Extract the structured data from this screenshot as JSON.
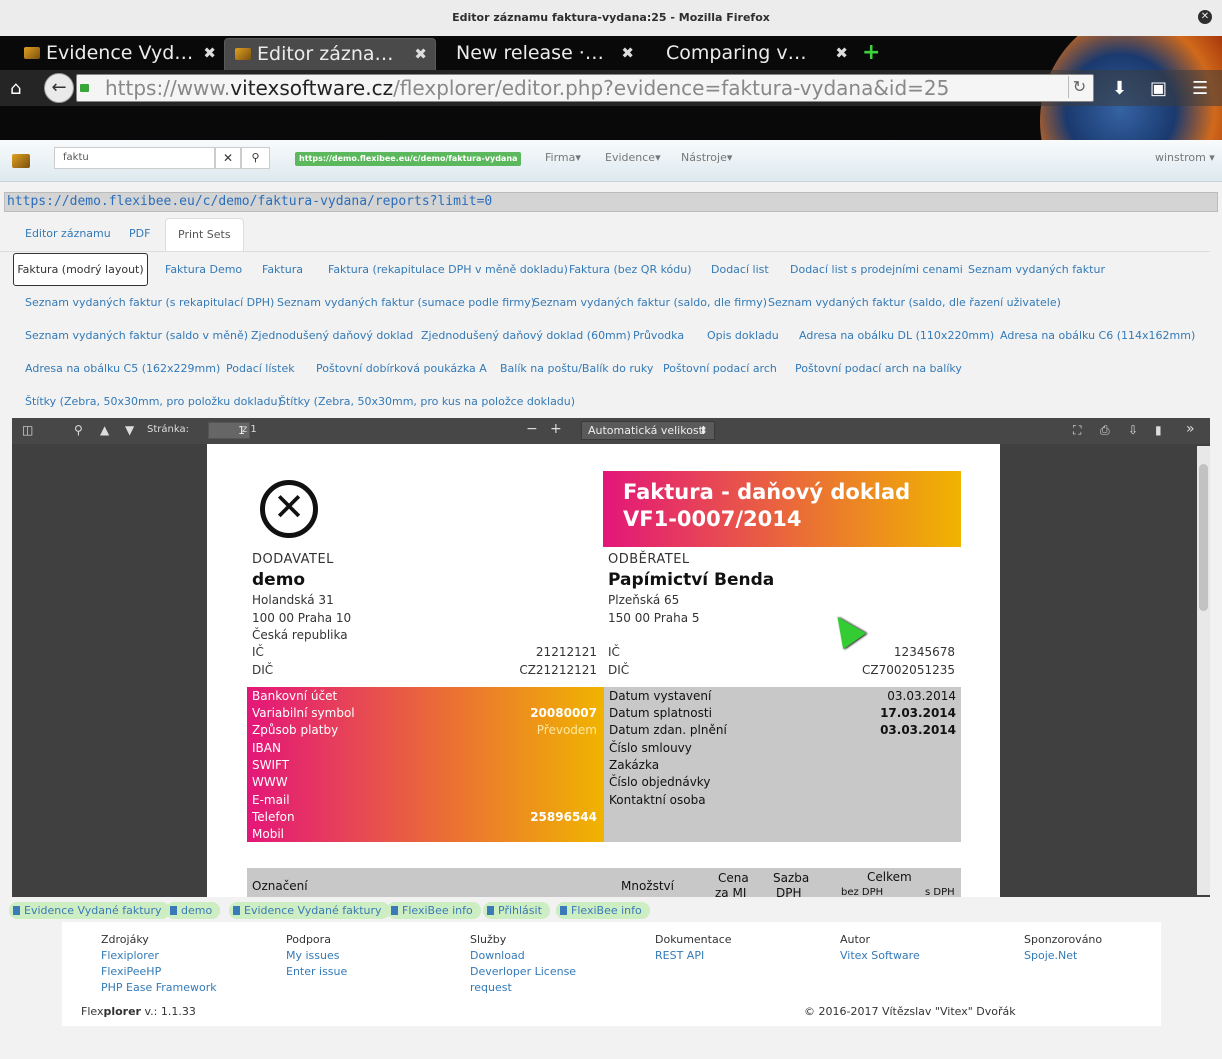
{
  "window": {
    "title": "Editor záznamu faktura-vydana:25 - Mozilla Firefox"
  },
  "browser": {
    "tabs": [
      {
        "label": "Evidence Vyd…"
      },
      {
        "label": "Editor zázna…"
      },
      {
        "label": "New release ·…"
      },
      {
        "label": "Comparing v…"
      }
    ],
    "url": {
      "scheme": "https://www.",
      "domain": "vitexsoftware.cz",
      "path": "/flexplorer/editor.php?evidence=faktura-vydana&id=25"
    }
  },
  "app": {
    "search": {
      "value": "faktu"
    },
    "source_badge": "https://demo.flexibee.eu/c/demo/faktura-vydana",
    "menu": [
      "Firma",
      "Evidence",
      "Nástroje"
    ],
    "user": "winstrom"
  },
  "report_url": "https://demo.flexibee.eu/c/demo/faktura-vydana/reports?limit=0",
  "tabs": [
    "Editor záznamu",
    "PDF",
    "Print Sets"
  ],
  "print_sets": [
    "Faktura (modrý layout)",
    "Faktura Demo",
    "Faktura",
    "Faktura (rekapitulace DPH v měně dokladu)",
    "Faktura (bez QR kódu)",
    "Dodací list",
    "Dodací list s prodejními cenami",
    "Seznam vydaných faktur",
    "Seznam vydaných faktur (s rekapitulací DPH)",
    "Seznam vydaných faktur (sumace podle firmy)",
    "Seznam vydaných faktur (saldo, dle firmy)",
    "Seznam vydaných faktur (saldo, dle řazení uživatele)",
    "Seznam vydaných faktur (saldo v měně)",
    "Zjednodušený daňový doklad",
    "Zjednodušený daňový doklad (60mm)",
    "Průvodka",
    "Opis dokladu",
    "Adresa na obálku DL (110x220mm)",
    "Adresa na obálku C6 (114x162mm)",
    "Adresa na obálku C5 (162x229mm)",
    "Podací lístek",
    "Poštovní dobírková poukázka A",
    "Balík na poštu/Balík do ruky",
    "Poštovní podací arch",
    "Poštovní podací arch na balíky",
    "Štítky (Zebra, 50x30mm, pro položku dokladu)",
    "Štítky (Zebra, 50x30mm, pro kus na položce dokladu)"
  ],
  "pdf_toolbar": {
    "page_label": "Stránka:",
    "page": "1",
    "page_total": "z 1",
    "zoom": "Automatická velikost"
  },
  "invoice": {
    "title_line1": "Faktura - daňový doklad",
    "title_line2": "VF1-0007/2014",
    "supplier": {
      "caption": "DODAVATEL",
      "name": "demo",
      "street": "Holandská 31",
      "city": "100 00   Praha 10",
      "country": "Česká republika",
      "ic_label": "IČ",
      "ic": "21212121",
      "dic_label": "DIČ",
      "dic": "CZ21212121"
    },
    "customer": {
      "caption": "ODBĚRATEL",
      "name": "Papímictví Benda",
      "street": "Plzeňská 65",
      "city": "150 00   Praha 5",
      "ic_label": "IČ",
      "ic": "12345678",
      "dic_label": "DIČ",
      "dic": "CZ7002051235"
    },
    "payment": [
      {
        "label": "Bankovní účet",
        "value": ""
      },
      {
        "label": "Variabilní symbol",
        "value": "20080007"
      },
      {
        "label": "Způsob platby",
        "value": "Převodem"
      },
      {
        "label": "IBAN",
        "value": ""
      },
      {
        "label": "SWIFT",
        "value": ""
      },
      {
        "label": "WWW",
        "value": ""
      },
      {
        "label": "E-mail",
        "value": ""
      },
      {
        "label": "Telefon",
        "value": "25896544"
      },
      {
        "label": "Mobil",
        "value": ""
      }
    ],
    "dates": [
      {
        "label": "Datum vystavení",
        "value": "03.03.2014"
      },
      {
        "label": "Datum splatnosti",
        "value": "17.03.2014"
      },
      {
        "label": "Datum zdan. plnění",
        "value": "03.03.2014"
      },
      {
        "label": "Číslo smlouvy",
        "value": ""
      },
      {
        "label": "Zakázka",
        "value": ""
      },
      {
        "label": "Číslo objednávky",
        "value": ""
      },
      {
        "label": "Kontaktní osoba",
        "value": ""
      }
    ],
    "table_header": {
      "col1": "Označení",
      "col2": "Množství",
      "col3a": "Cena",
      "col3b": "za MJ",
      "col4a": "Sazba",
      "col4b": "DPH",
      "col5": "Celkem",
      "col5a": "bez DPH",
      "col5b": "s DPH"
    }
  },
  "badges": [
    "Evidence Vydané faktury",
    "demo",
    "Evidence Vydané faktury",
    "FlexiBee info",
    "Přihlásit",
    "FlexiBee info"
  ],
  "footer": {
    "columns": [
      {
        "head": "Zdrojáky",
        "links": [
          "Flexiplorer",
          "FlexiPeeHP",
          "PHP Ease Framework"
        ]
      },
      {
        "head": "Podpora",
        "links": [
          "My issues",
          "Enter issue"
        ]
      },
      {
        "head": "Služby",
        "links": [
          "Download",
          "Deverloper License",
          "request"
        ]
      },
      {
        "head": "Dokumentace",
        "links": [
          "REST API"
        ]
      },
      {
        "head": "Autor",
        "links": [
          "Vitex Software"
        ]
      },
      {
        "head": "Sponzorováno",
        "links": [
          "Spoje.Net"
        ]
      }
    ],
    "version_prefix": "Flex",
    "version_brand": "plorer",
    "version_suffix": " v.: 1.1.33",
    "copyright": "© 2016-2017 Vítězslav \"Vitex\" Dvořák"
  }
}
